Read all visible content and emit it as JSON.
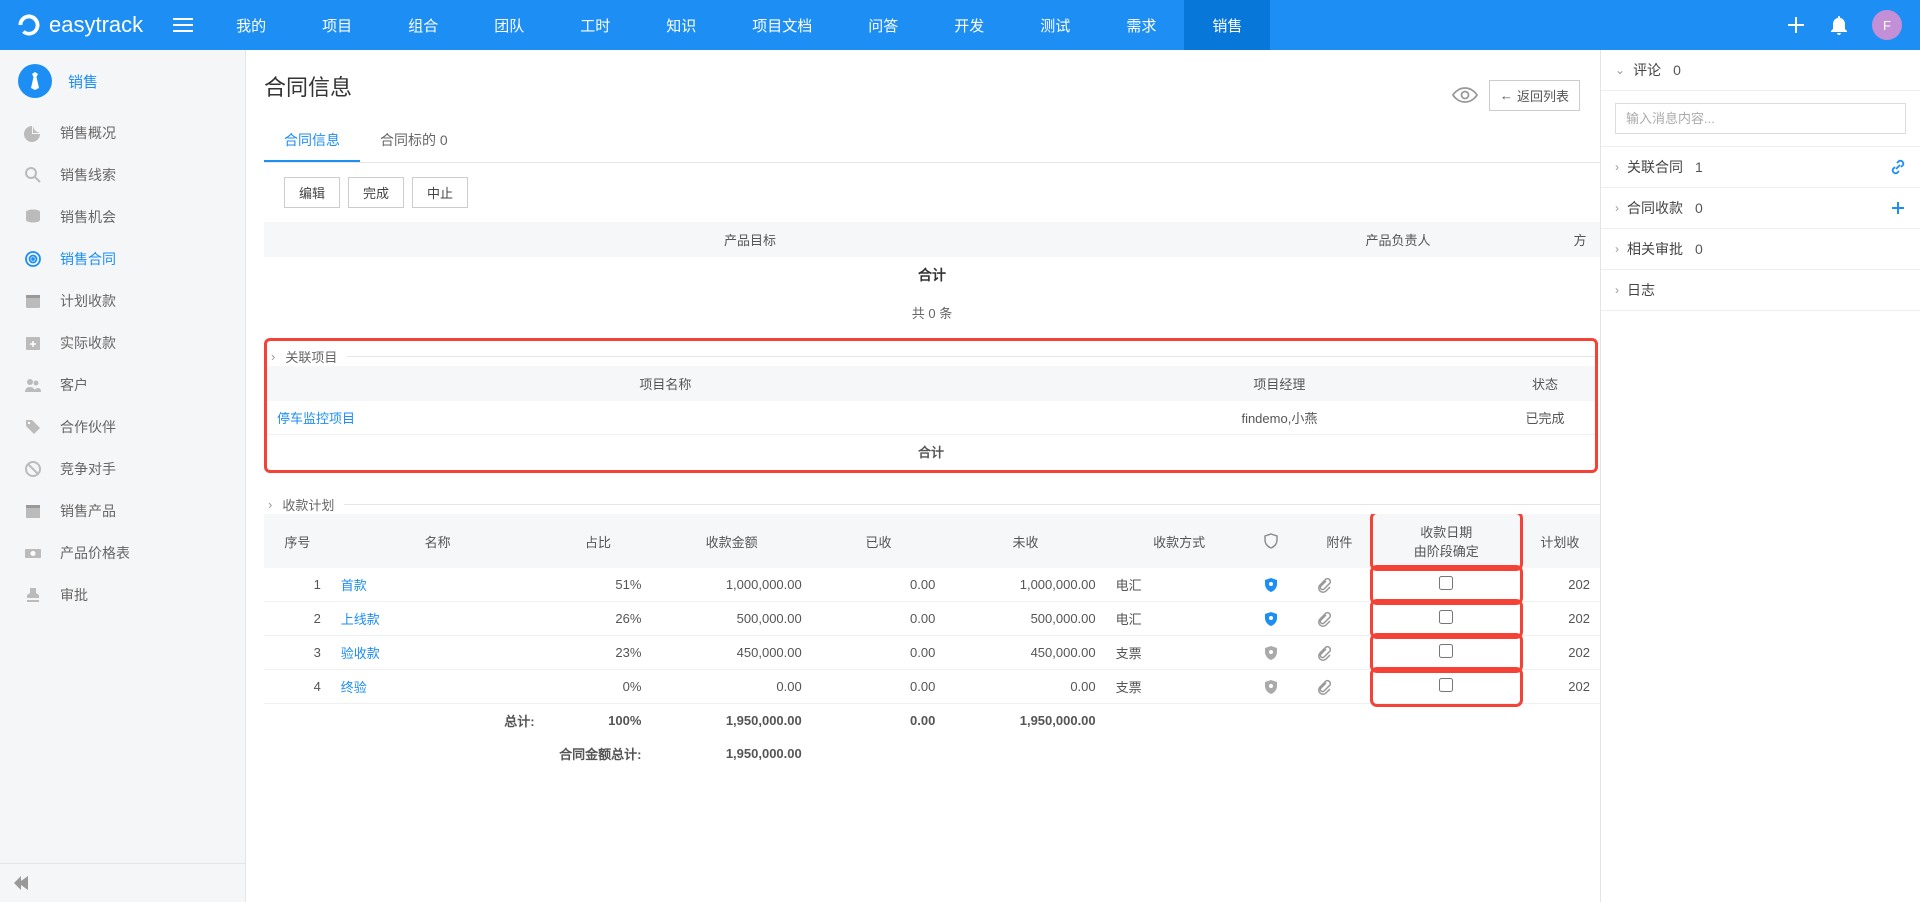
{
  "topbar": {
    "logo": "easytrack",
    "nav": [
      "我的",
      "项目",
      "组合",
      "团队",
      "工时",
      "知识",
      "项目文档",
      "问答",
      "开发",
      "测试",
      "需求",
      "销售"
    ],
    "active_nav_index": 11,
    "avatar_letter": "F"
  },
  "sidebar": {
    "header": "销售",
    "items": [
      {
        "label": "销售概况",
        "icon": "pie"
      },
      {
        "label": "销售线索",
        "icon": "search"
      },
      {
        "label": "销售机会",
        "icon": "coins"
      },
      {
        "label": "销售合同",
        "icon": "target",
        "active": true
      },
      {
        "label": "计划收款",
        "icon": "calendar"
      },
      {
        "label": "实际收款",
        "icon": "calendar-plus"
      },
      {
        "label": "客户",
        "icon": "users"
      },
      {
        "label": "合作伙伴",
        "icon": "tag"
      },
      {
        "label": "竞争对手",
        "icon": "forbid"
      },
      {
        "label": "销售产品",
        "icon": "box"
      },
      {
        "label": "产品价格表",
        "icon": "money"
      },
      {
        "label": "审批",
        "icon": "stamp"
      }
    ]
  },
  "page": {
    "title": "合同信息",
    "return_btn": "返回列表",
    "tabs": [
      {
        "label": "合同信息",
        "active": true
      },
      {
        "label": "合同标的 0"
      }
    ],
    "buttons": [
      "编辑",
      "完成",
      "中止"
    ]
  },
  "products_section": {
    "header_cols": [
      "产品目标",
      "产品负责人",
      "方"
    ],
    "subtotal_label": "合计",
    "count_text": "共 0 条"
  },
  "projects_section": {
    "title": "关联项目",
    "columns": [
      "项目名称",
      "项目经理",
      "状态"
    ],
    "rows": [
      {
        "name": "停车监控项目",
        "manager": "findemo,小燕",
        "status": "已完成"
      }
    ],
    "subtotal_label": "合计"
  },
  "payment_section": {
    "title": "收款计划",
    "columns": {
      "seq": "序号",
      "name": "名称",
      "ratio": "占比",
      "amount": "收款金额",
      "received": "已收",
      "unreceived": "未收",
      "method": "收款方式",
      "attachment": "附件",
      "date_by_stage": "收款日期\n由阶段确定",
      "plan": "计划收"
    },
    "rows": [
      {
        "seq": 1,
        "name": "首款",
        "ratio": "51%",
        "amount": "1,000,000.00",
        "received": "0.00",
        "unreceived": "1,000,000.00",
        "method": "电汇",
        "shield": "active",
        "plan": "202"
      },
      {
        "seq": 2,
        "name": "上线款",
        "ratio": "26%",
        "amount": "500,000.00",
        "received": "0.00",
        "unreceived": "500,000.00",
        "method": "电汇",
        "shield": "active",
        "plan": "202"
      },
      {
        "seq": 3,
        "name": "验收款",
        "ratio": "23%",
        "amount": "450,000.00",
        "received": "0.00",
        "unreceived": "450,000.00",
        "method": "支票",
        "shield": "dim",
        "plan": "202"
      },
      {
        "seq": 4,
        "name": "终验",
        "ratio": "0%",
        "amount": "0.00",
        "received": "0.00",
        "unreceived": "0.00",
        "method": "支票",
        "shield": "dim",
        "plan": "202"
      }
    ],
    "totals": {
      "label": "总计:",
      "ratio": "100%",
      "amount": "1,950,000.00",
      "received": "0.00",
      "unreceived": "1,950,000.00"
    },
    "grand": {
      "label": "合同金额总计:",
      "amount": "1,950,000.00"
    }
  },
  "right_panel": {
    "comments": {
      "label": "评论",
      "count": "0",
      "placeholder": "输入消息内容..."
    },
    "sections": [
      {
        "label": "关联合同",
        "count": "1",
        "icon": "link"
      },
      {
        "label": "合同收款",
        "count": "0",
        "icon": "plus"
      },
      {
        "label": "相关审批",
        "count": "0"
      },
      {
        "label": "日志"
      }
    ]
  }
}
